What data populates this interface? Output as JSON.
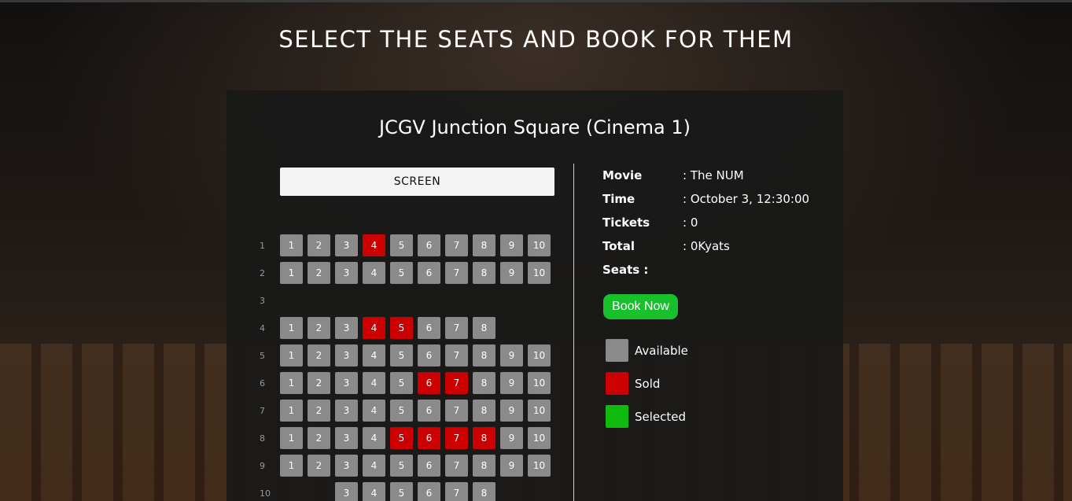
{
  "page": {
    "title": "SELECT THE SEATS AND BOOK FOR THEM"
  },
  "cinema": {
    "title": "JCGV Junction Square (Cinema 1)",
    "screen_label": "SCREEN"
  },
  "colors": {
    "available": "#8a8a8a",
    "sold": "#cc0000",
    "selected": "#0fba0f",
    "book_button": "#18c12c"
  },
  "rows": [
    {
      "label": "1",
      "seats": [
        {
          "n": "1",
          "s": "available"
        },
        {
          "n": "2",
          "s": "available"
        },
        {
          "n": "3",
          "s": "available"
        },
        {
          "n": "4",
          "s": "sold"
        },
        {
          "n": "5",
          "s": "available"
        },
        {
          "n": "6",
          "s": "available"
        },
        {
          "n": "7",
          "s": "available"
        },
        {
          "n": "8",
          "s": "available"
        },
        {
          "n": "9",
          "s": "available"
        },
        {
          "n": "10",
          "s": "available"
        }
      ]
    },
    {
      "label": "2",
      "seats": [
        {
          "n": "1",
          "s": "available"
        },
        {
          "n": "2",
          "s": "available"
        },
        {
          "n": "3",
          "s": "available"
        },
        {
          "n": "4",
          "s": "available"
        },
        {
          "n": "5",
          "s": "available"
        },
        {
          "n": "6",
          "s": "available"
        },
        {
          "n": "7",
          "s": "available"
        },
        {
          "n": "8",
          "s": "available"
        },
        {
          "n": "9",
          "s": "available"
        },
        {
          "n": "10",
          "s": "available"
        }
      ]
    },
    {
      "label": "3",
      "seats": []
    },
    {
      "label": "4",
      "seats": [
        {
          "n": "1",
          "s": "available"
        },
        {
          "n": "2",
          "s": "available"
        },
        {
          "n": "3",
          "s": "available"
        },
        {
          "n": "4",
          "s": "sold"
        },
        {
          "n": "5",
          "s": "sold"
        },
        {
          "n": "6",
          "s": "available"
        },
        {
          "n": "7",
          "s": "available"
        },
        {
          "n": "8",
          "s": "available"
        }
      ]
    },
    {
      "label": "5",
      "seats": [
        {
          "n": "1",
          "s": "available"
        },
        {
          "n": "2",
          "s": "available"
        },
        {
          "n": "3",
          "s": "available"
        },
        {
          "n": "4",
          "s": "available"
        },
        {
          "n": "5",
          "s": "available"
        },
        {
          "n": "6",
          "s": "available"
        },
        {
          "n": "7",
          "s": "available"
        },
        {
          "n": "8",
          "s": "available"
        },
        {
          "n": "9",
          "s": "available"
        },
        {
          "n": "10",
          "s": "available"
        }
      ]
    },
    {
      "label": "6",
      "seats": [
        {
          "n": "1",
          "s": "available"
        },
        {
          "n": "2",
          "s": "available"
        },
        {
          "n": "3",
          "s": "available"
        },
        {
          "n": "4",
          "s": "available"
        },
        {
          "n": "5",
          "s": "available"
        },
        {
          "n": "6",
          "s": "sold"
        },
        {
          "n": "7",
          "s": "sold"
        },
        {
          "n": "8",
          "s": "available"
        },
        {
          "n": "9",
          "s": "available"
        },
        {
          "n": "10",
          "s": "available"
        }
      ]
    },
    {
      "label": "7",
      "seats": [
        {
          "n": "1",
          "s": "available"
        },
        {
          "n": "2",
          "s": "available"
        },
        {
          "n": "3",
          "s": "available"
        },
        {
          "n": "4",
          "s": "available"
        },
        {
          "n": "5",
          "s": "available"
        },
        {
          "n": "6",
          "s": "available"
        },
        {
          "n": "7",
          "s": "available"
        },
        {
          "n": "8",
          "s": "available"
        },
        {
          "n": "9",
          "s": "available"
        },
        {
          "n": "10",
          "s": "available"
        }
      ]
    },
    {
      "label": "8",
      "seats": [
        {
          "n": "1",
          "s": "available"
        },
        {
          "n": "2",
          "s": "available"
        },
        {
          "n": "3",
          "s": "available"
        },
        {
          "n": "4",
          "s": "available"
        },
        {
          "n": "5",
          "s": "sold"
        },
        {
          "n": "6",
          "s": "sold"
        },
        {
          "n": "7",
          "s": "sold"
        },
        {
          "n": "8",
          "s": "sold"
        },
        {
          "n": "9",
          "s": "available"
        },
        {
          "n": "10",
          "s": "available"
        }
      ]
    },
    {
      "label": "9",
      "seats": [
        {
          "n": "1",
          "s": "available"
        },
        {
          "n": "2",
          "s": "available"
        },
        {
          "n": "3",
          "s": "available"
        },
        {
          "n": "4",
          "s": "available"
        },
        {
          "n": "5",
          "s": "available"
        },
        {
          "n": "6",
          "s": "available"
        },
        {
          "n": "7",
          "s": "available"
        },
        {
          "n": "8",
          "s": "available"
        },
        {
          "n": "9",
          "s": "available"
        },
        {
          "n": "10",
          "s": "available"
        }
      ]
    },
    {
      "label": "10",
      "seats": [
        {
          "n": "3",
          "s": "available"
        },
        {
          "n": "4",
          "s": "available"
        },
        {
          "n": "5",
          "s": "available"
        },
        {
          "n": "6",
          "s": "available"
        },
        {
          "n": "7",
          "s": "available"
        },
        {
          "n": "8",
          "s": "available"
        }
      ]
    }
  ],
  "info": {
    "movie_label": "Movie",
    "movie_value": ": The NUM",
    "time_label": "Time",
    "time_value": ": October 3, 12:30:00",
    "tickets_label": "Tickets",
    "tickets_value": ": 0",
    "total_label": "Total",
    "total_value": ": 0Kyats",
    "seats_label": "Seats :"
  },
  "book_button": "Book Now",
  "legend": {
    "available": "Available",
    "sold": "Sold",
    "selected": "Selected"
  }
}
